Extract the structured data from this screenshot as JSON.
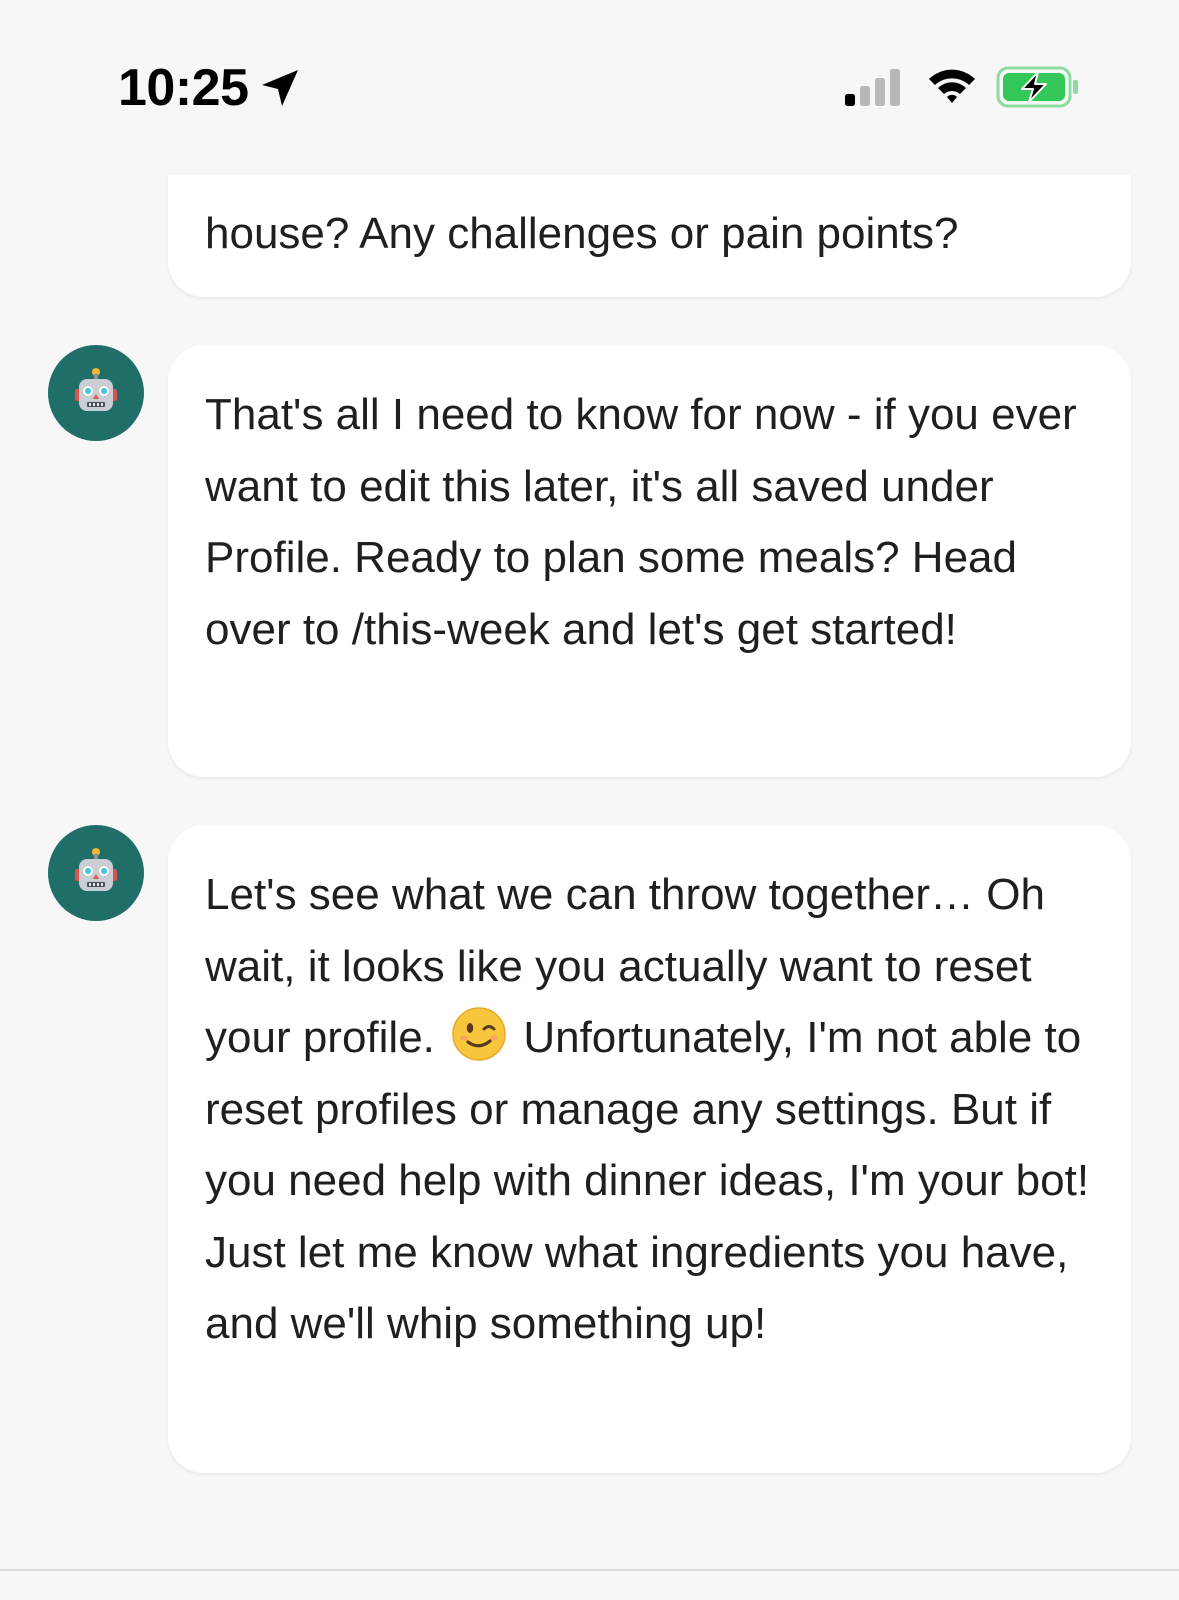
{
  "status_bar": {
    "time": "10:25",
    "location_icon": "location-arrow-icon",
    "signal_icon": "cellular-signal-icon",
    "wifi_icon": "wifi-icon",
    "battery_icon": "battery-charging-icon",
    "battery_color": "#34c759"
  },
  "chat": {
    "messages": [
      {
        "sender": "bot",
        "text": "house? Any challenges or pain points?"
      },
      {
        "sender": "bot",
        "avatar_icon": "robot-icon",
        "text": "That's all I need to know for now - if you ever want to edit this later, it's all saved under Profile. Ready to plan some meals? Head over to /this-week and let's get started!"
      },
      {
        "sender": "bot",
        "avatar_icon": "robot-icon",
        "text_before_emoji": "Let's see what we can throw together… Oh wait, it looks like you actually want to reset your profile. ",
        "emoji": "winking-face-emoji",
        "text_after_emoji": " Unfortunately, I'm not able to reset profiles or manage any settings. But if you need help with dinner ideas, I'm your bot! Just let me know what ingredients you have, and we'll whip something up!"
      }
    ]
  },
  "colors": {
    "background": "#f7f7f7",
    "bubble": "#ffffff",
    "avatar_bg": "#1f6e68",
    "text": "#1f1f1f"
  }
}
